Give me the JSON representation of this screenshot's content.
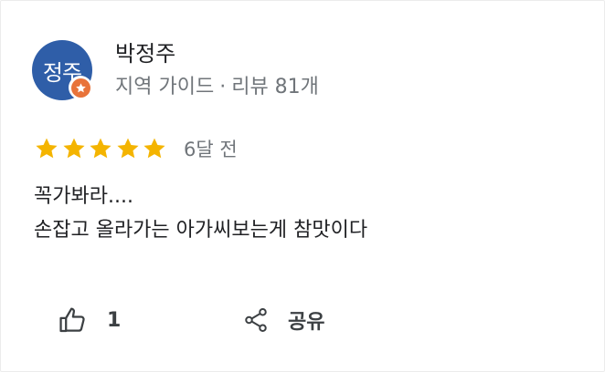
{
  "review": {
    "author": {
      "avatar_text": "정주",
      "name": "박정주",
      "role": "지역 가이드",
      "separator": "·",
      "review_count": "리뷰 81개",
      "badge_icon": "local-guide-star-icon"
    },
    "rating": {
      "stars": 5,
      "max_stars": 5,
      "star_color": "#f4b400",
      "time": "6달 전"
    },
    "text_lines": [
      "꼭가봐라....",
      "손잡고 올라가는 아가씨보는게 참맛이다"
    ],
    "actions": {
      "like_icon": "thumbs-up-icon",
      "like_count": "1",
      "share_icon": "share-icon",
      "share_label": "공유"
    }
  },
  "colors": {
    "avatar_bg": "#2f5ea8",
    "badge_bg": "#e8733a",
    "meta_text": "#70757a"
  }
}
